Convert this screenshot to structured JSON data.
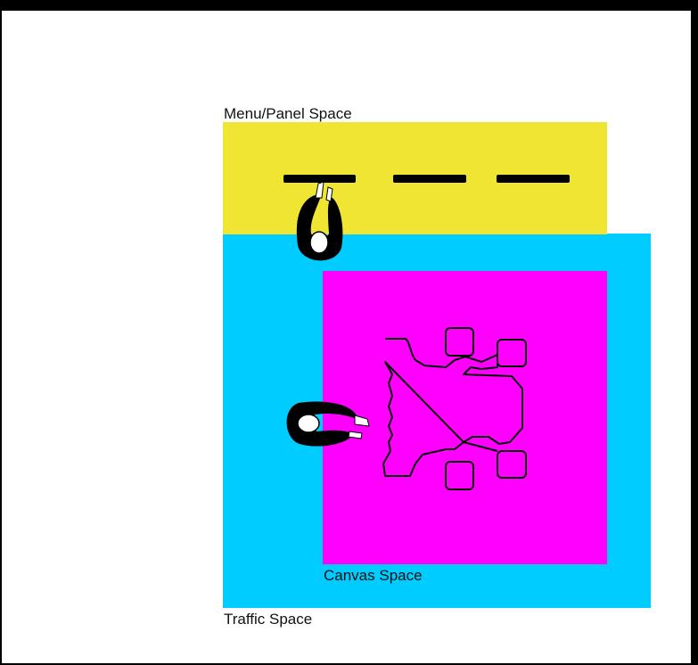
{
  "labels": {
    "menu_panel": "Menu/Panel Space",
    "canvas": "Canvas Space",
    "traffic": "Traffic Space"
  },
  "colors": {
    "menu_panel_zone": "#f0e532",
    "traffic_zone": "#00ccff",
    "canvas_zone": "#ff00ff",
    "outline": "#000000"
  },
  "icons": {
    "person_top": "person-icon",
    "person_left": "person-icon",
    "device": "robot-icon",
    "menu_items": "menu-bar-icon"
  }
}
